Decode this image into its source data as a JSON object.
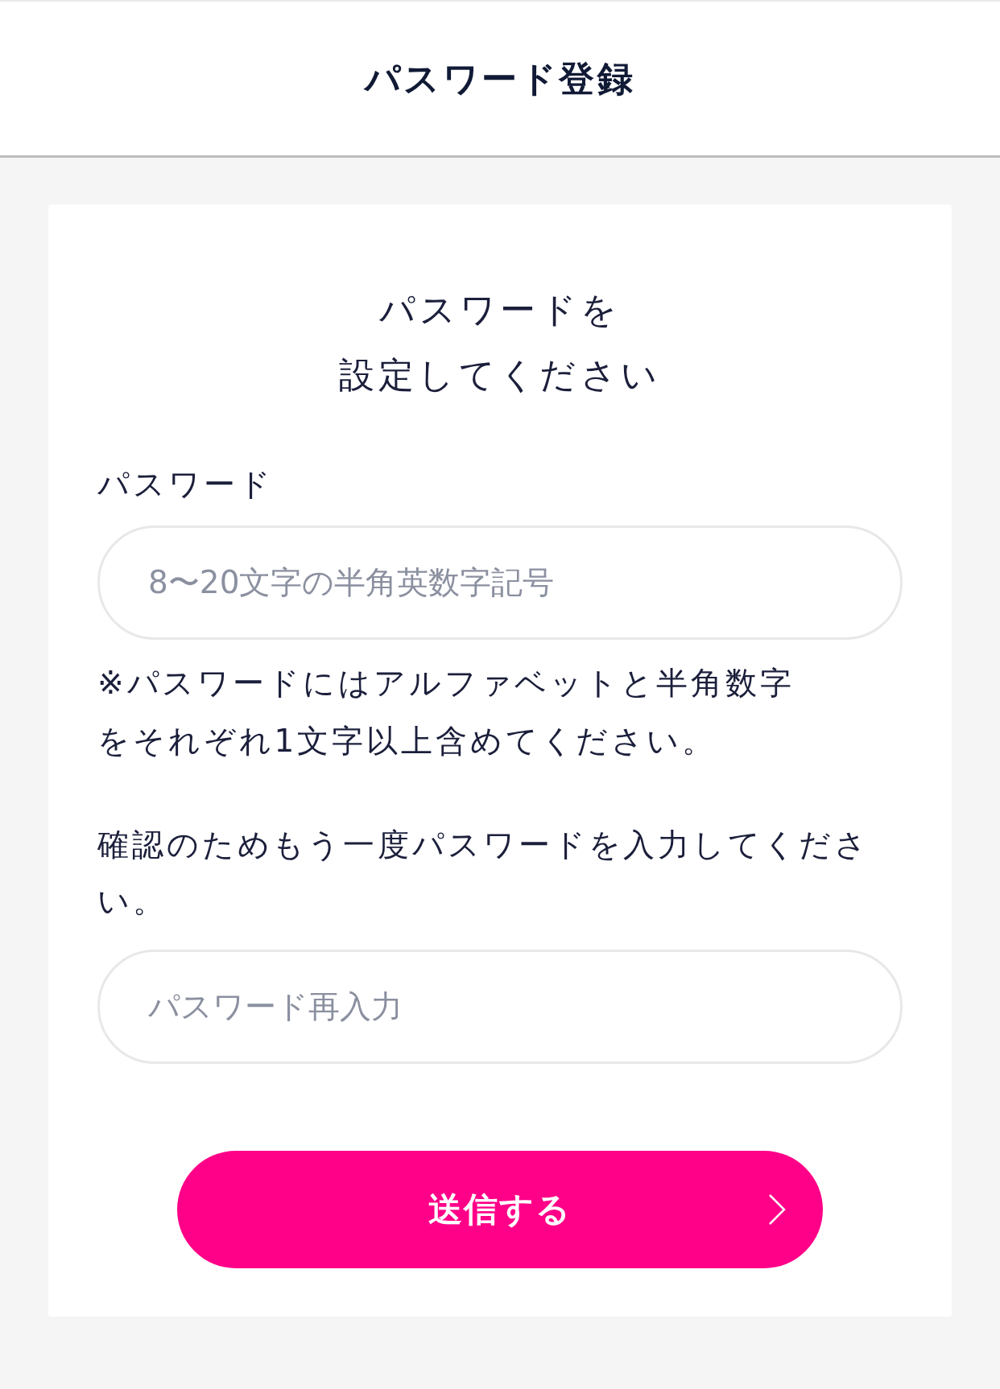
{
  "header": {
    "title": "パスワード登録"
  },
  "form": {
    "heading_lines": [
      "パスワードを",
      "設定してください"
    ],
    "password": {
      "label": "パスワード",
      "placeholder": "8〜20文字の半角英数字記号"
    },
    "note": "※パスワードにはアルファベットと半角数字をそれぞれ1文字以上含めてください。",
    "confirm": {
      "label": "確認のためもう一度パスワードを入力してください。",
      "placeholder": "パスワード再入力"
    },
    "submit": {
      "label": "送信する"
    }
  }
}
